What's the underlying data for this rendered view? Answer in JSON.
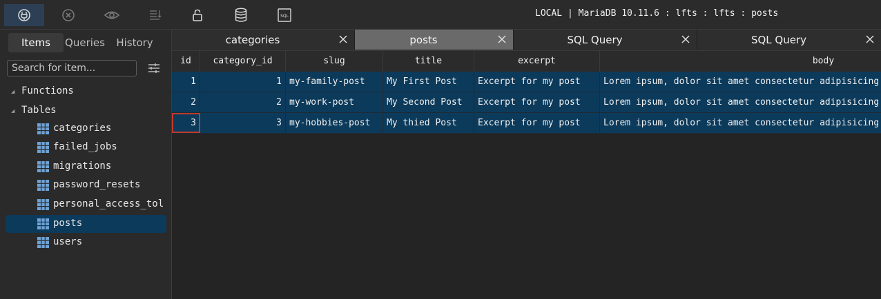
{
  "toolbar": {
    "buttons": [
      {
        "name": "connections-icon",
        "active": true
      },
      {
        "name": "disconnect-icon",
        "active": false
      },
      {
        "name": "view-icon",
        "active": false
      },
      {
        "name": "sort-icon",
        "active": false
      },
      {
        "name": "lock-icon",
        "active": false
      },
      {
        "name": "database-icon",
        "active": false
      },
      {
        "name": "sql-icon",
        "active": false
      }
    ],
    "sql_icon_text": "SQL",
    "connection": "LOCAL | MariaDB 10.11.6 : lfts : lfts : posts"
  },
  "sidebar": {
    "tabs": [
      "Items",
      "Queries",
      "History"
    ],
    "active_tab": "Items",
    "search_placeholder": "Search for item...",
    "groups": [
      "Functions",
      "Tables"
    ],
    "tables": [
      "categories",
      "failed_jobs",
      "migrations",
      "password_resets",
      "personal_access_tol",
      "posts",
      "users"
    ],
    "selected_table": "posts"
  },
  "tabs": [
    {
      "label": "categories",
      "active": false
    },
    {
      "label": "posts",
      "active": true
    },
    {
      "label": "SQL Query",
      "active": false
    },
    {
      "label": "SQL Query",
      "active": false
    }
  ],
  "grid": {
    "columns": [
      "id",
      "category_id",
      "slug",
      "title",
      "excerpt",
      "body"
    ],
    "rows": [
      [
        "1",
        "1",
        "my-family-post",
        "My First Post",
        "Excerpt for my post",
        "Lorem ipsum, dolor sit amet consectetur adipisicing elit."
      ],
      [
        "2",
        "2",
        "my-work-post",
        "My Second Post",
        "Excerpt for my post",
        "Lorem ipsum, dolor sit amet consectetur adipisicing elit."
      ],
      [
        "3",
        "3",
        "my-hobbies-post",
        "My thied Post",
        "Excerpt for my post",
        "Lorem ipsum, dolor sit amet consectetur adipisicing elit."
      ]
    ],
    "focused_cell": {
      "row": 2,
      "column": "id"
    }
  },
  "colors": {
    "accent": "#0c3a5b",
    "active_tab": "#6a6a6a",
    "focus_outline": "#c0392b",
    "table_icon": "#6fa3d6"
  }
}
